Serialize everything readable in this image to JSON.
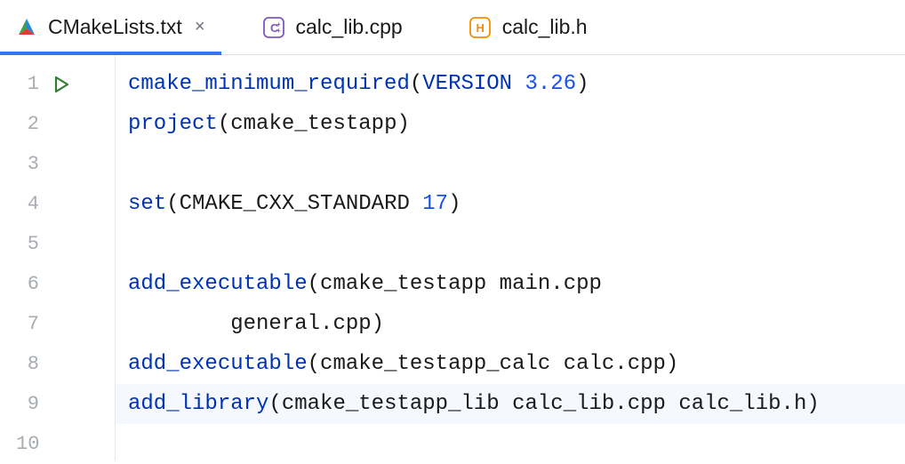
{
  "tabs": [
    {
      "label": "CMakeLists.txt",
      "active": true,
      "closeable": true
    },
    {
      "label": "calc_lib.cpp",
      "active": false,
      "closeable": false
    },
    {
      "label": "calc_lib.h",
      "active": false,
      "closeable": false
    }
  ],
  "lineNumbers": [
    "1",
    "2",
    "3",
    "4",
    "5",
    "6",
    "7",
    "8",
    "9",
    "10"
  ],
  "highlightedLine": 9,
  "code": {
    "l1": {
      "fn": "cmake_minimum_required",
      "p1": "(",
      "kw": "VERSION",
      "sp": " ",
      "num": "3.26",
      "p2": ")"
    },
    "l2": {
      "fn": "project",
      "p1": "(",
      "arg": "cmake_testapp",
      "p2": ")"
    },
    "l4": {
      "fn": "set",
      "p1": "(",
      "arg": "CMAKE_CXX_STANDARD",
      "sp": " ",
      "num": "17",
      "p2": ")"
    },
    "l6": {
      "fn": "add_executable",
      "p1": "(",
      "arg": "cmake_testapp main.cpp"
    },
    "l7": {
      "indent": "        ",
      "arg": "general.cpp",
      "p2": ")"
    },
    "l8": {
      "fn": "add_executable",
      "p1": "(",
      "arg": "cmake_testapp_calc calc.cpp",
      "p2": ")"
    },
    "l9": {
      "fn": "add_library",
      "p1": "(",
      "arg": "cmake_testapp_lib calc_lib.cpp calc_lib.h",
      "p2": ")"
    }
  }
}
